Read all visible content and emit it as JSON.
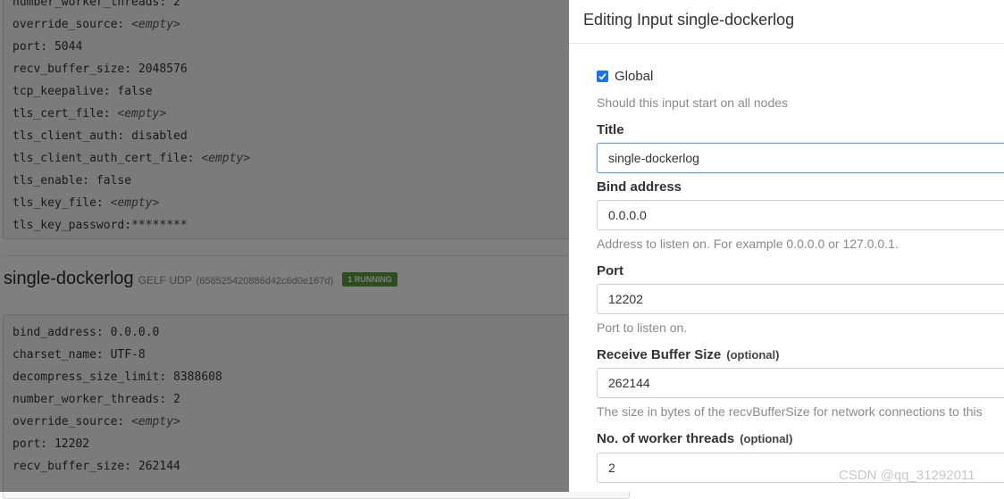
{
  "background": {
    "top_config_lines": [
      {
        "key": "number_worker_threads:",
        "value": "2"
      },
      {
        "key": "override_source:",
        "value": "<empty>",
        "italic": true
      },
      {
        "key": "port:",
        "value": "5044"
      },
      {
        "key": "recv_buffer_size:",
        "value": "2048576"
      },
      {
        "key": "tcp_keepalive:",
        "value": "false"
      },
      {
        "key": "tls_cert_file:",
        "value": "<empty>",
        "italic": true
      },
      {
        "key": "tls_client_auth:",
        "value": "disabled"
      },
      {
        "key": "tls_client_auth_cert_file:",
        "value": "<empty>",
        "italic": true
      },
      {
        "key": "tls_enable:",
        "value": "false"
      },
      {
        "key": "tls_key_file:",
        "value": "<empty>",
        "italic": true
      },
      {
        "key": "tls_key_password:",
        "value": "********",
        "nospace": true
      }
    ],
    "input_heading": {
      "name": "single-dockerlog",
      "type": "GELF UDP",
      "id": "(658525420886d42c6d0e167d)",
      "status_badge": "1 RUNNING"
    },
    "bottom_config_lines": [
      {
        "key": "bind_address:",
        "value": "0.0.0.0"
      },
      {
        "key": "charset_name:",
        "value": "UTF-8"
      },
      {
        "key": "decompress_size_limit:",
        "value": "8388608"
      },
      {
        "key": "number_worker_threads:",
        "value": "2"
      },
      {
        "key": "override_source:",
        "value": "<empty>",
        "italic": true
      },
      {
        "key": "port:",
        "value": "12202"
      },
      {
        "key": "recv_buffer_size:",
        "value": "262144"
      }
    ]
  },
  "modal": {
    "title": "Editing Input single-dockerlog",
    "global": {
      "label": "Global",
      "checked": true,
      "help": "Should this input start on all nodes"
    },
    "title_field": {
      "label": "Title",
      "value": "single-dockerlog"
    },
    "bind_address": {
      "label": "Bind address",
      "value": "0.0.0.0",
      "help": "Address to listen on. For example 0.0.0.0 or 127.0.0.1."
    },
    "port": {
      "label": "Port",
      "value": "12202",
      "help": "Port to listen on."
    },
    "recv_buffer": {
      "label": "Receive Buffer Size",
      "optional": "(optional)",
      "value": "262144",
      "help": "The size in bytes of the recvBufferSize for network connections to this"
    },
    "worker_threads": {
      "label": "No. of worker threads",
      "optional": "(optional)",
      "value": "2"
    }
  },
  "watermark": "CSDN @qq_31292011",
  "colors": {
    "checkbox": "#1a73e8",
    "badge": "#5b9a3c",
    "overlay": "rgba(0,0,0,0.5)"
  }
}
